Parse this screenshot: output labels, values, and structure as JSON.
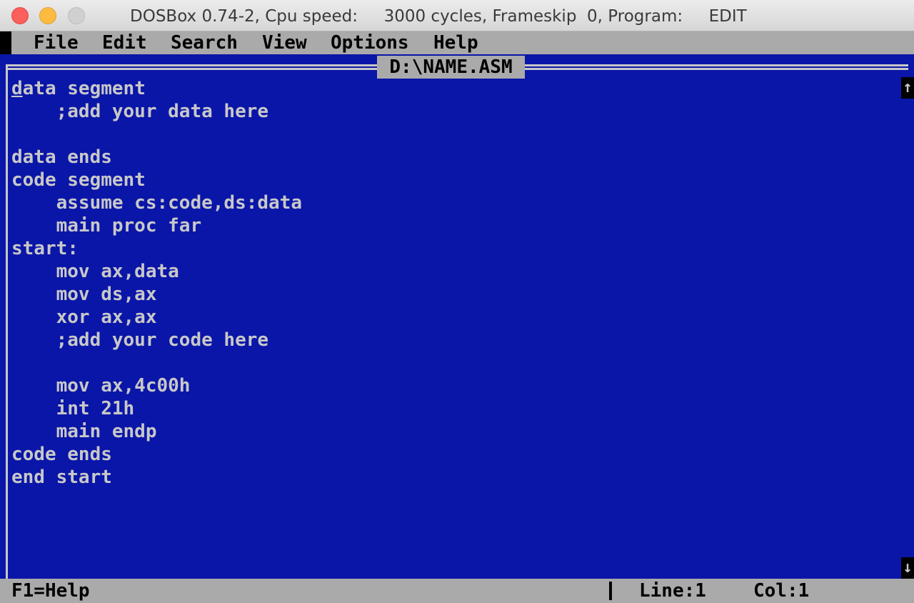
{
  "window": {
    "title": "DOSBox 0.74-2, Cpu speed:     3000 cycles, Frameskip  0, Program:     EDIT"
  },
  "menu": {
    "items": [
      {
        "label": "File"
      },
      {
        "label": "Edit"
      },
      {
        "label": "Search"
      },
      {
        "label": "View"
      },
      {
        "label": "Options"
      },
      {
        "label": "Help"
      }
    ]
  },
  "editor": {
    "filename": "D:\\NAME.ASM",
    "scroll_up": "↑",
    "scroll_down": "↓",
    "cursor_char": "d",
    "first_line_rest": "ata segment",
    "lines": [
      "    ;add your data here",
      "",
      "data ends",
      "code segment",
      "    assume cs:code,ds:data",
      "    main proc far",
      "start:",
      "    mov ax,data",
      "    mov ds,ax",
      "    xor ax,ax",
      "    ;add your code here",
      "",
      "    mov ax,4c00h",
      "    int 21h",
      "    main endp",
      "code ends",
      "end start"
    ]
  },
  "status": {
    "help": "F1=Help",
    "line": "Line:1",
    "col": "Col:1"
  },
  "colors": {
    "editor_bg": "#0a16a8",
    "text": "#c8c8c8",
    "bar_bg": "#aaaaaa"
  }
}
